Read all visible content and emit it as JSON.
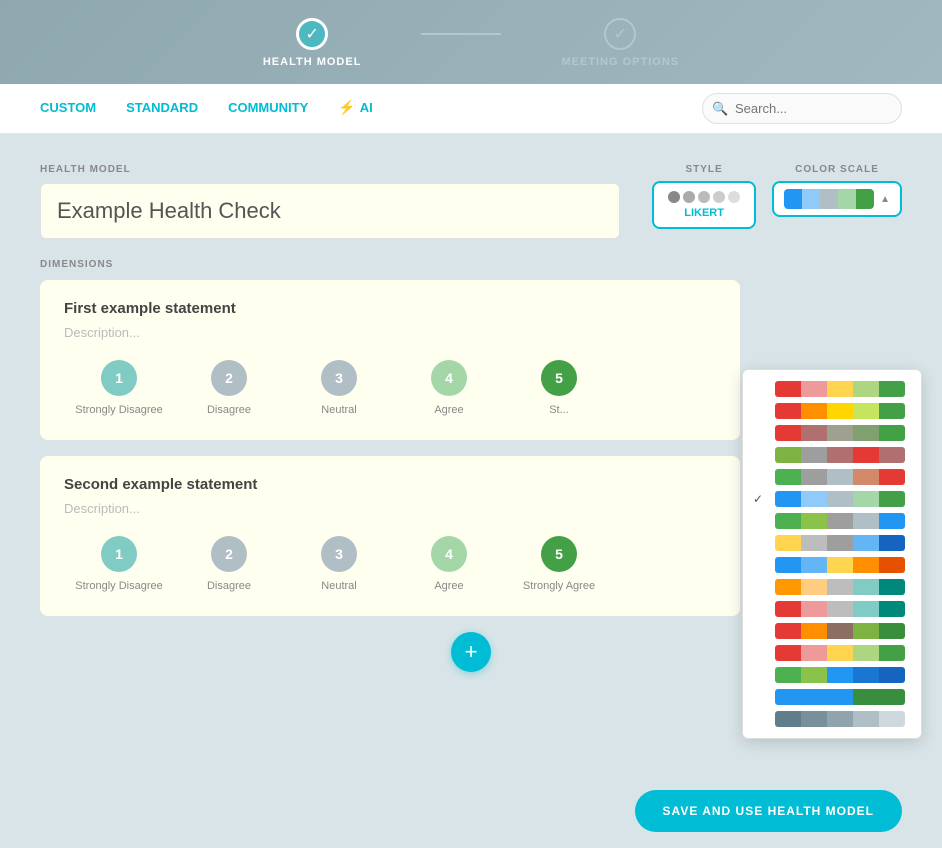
{
  "stepper": {
    "steps": [
      {
        "id": "health-model",
        "label": "HEALTH MODEL",
        "state": "active"
      },
      {
        "id": "meeting-options",
        "label": "MEETING OPTIONS",
        "state": "inactive"
      }
    ]
  },
  "nav": {
    "tabs": [
      {
        "id": "custom",
        "label": "CUSTOM"
      },
      {
        "id": "standard",
        "label": "STANDARD"
      },
      {
        "id": "community",
        "label": "COMMUNITY"
      },
      {
        "id": "ai",
        "label": "AI"
      }
    ],
    "search": {
      "placeholder": "Search...",
      "value": ""
    }
  },
  "health_model": {
    "label": "HEALTH MODEL",
    "name": "Example Health Check"
  },
  "style": {
    "label": "STYLE",
    "selected": "LIKERT"
  },
  "color_scale": {
    "label": "COLOR SCALE",
    "selected_index": 5,
    "options": [
      {
        "colors": [
          "#e53935",
          "#ef9a9a",
          "#ffd54f",
          "#aed581",
          "#43a047"
        ]
      },
      {
        "colors": [
          "#e53935",
          "#ff8f00",
          "#ffd600",
          "#c6e55e",
          "#43a047"
        ]
      },
      {
        "colors": [
          "#e53935",
          "#b07070",
          "#a0a090",
          "#80a070",
          "#43a047"
        ]
      },
      {
        "colors": [
          "#7cb342",
          "#9e9e9e",
          "#b07070",
          "#e53935",
          "#b07070"
        ]
      },
      {
        "colors": [
          "#4caf50",
          "#9e9e9e",
          "#b0bec5",
          "#d4886a",
          "#e53935"
        ]
      },
      {
        "colors": [
          "#2196f3",
          "#90caf9",
          "#b0bec5",
          "#a5d6a7",
          "#43a047"
        ]
      },
      {
        "colors": [
          "#4caf50",
          "#8bc34a",
          "#9e9e9e",
          "#b0bec5",
          "#2196f3"
        ]
      },
      {
        "colors": [
          "#ffd54f",
          "#bdbdbd",
          "#9e9e9e",
          "#64b5f6",
          "#1565c0"
        ]
      },
      {
        "colors": [
          "#2196f3",
          "#64b5f6",
          "#ffd54f",
          "#ff8f00",
          "#e65100"
        ]
      },
      {
        "colors": [
          "#ff9800",
          "#ffcc80",
          "#bdbdbd",
          "#80cbc4",
          "#00897b"
        ]
      },
      {
        "colors": [
          "#e53935",
          "#ef9a9a",
          "#bdbdbd",
          "#80cbc4",
          "#00897b"
        ]
      },
      {
        "colors": [
          "#e53935",
          "#ff8f00",
          "#8d6e63",
          "#7cb342",
          "#388e3c"
        ]
      },
      {
        "colors": [
          "#e53935",
          "#ef9a9a",
          "#ffd54f",
          "#aed581",
          "#43a047"
        ]
      },
      {
        "colors": [
          "#4caf50",
          "#8bc34a",
          "#2196f3",
          "#1976d2",
          "#1565c0"
        ]
      },
      {
        "colors": [
          "#2196f3",
          "#2196f3",
          "#2196f3",
          "#388e3c",
          "#388e3c"
        ]
      },
      {
        "colors": [
          "#607d8b",
          "#78909c",
          "#90a4ae",
          "#b0bec5",
          "#cfd8dc"
        ]
      }
    ]
  },
  "dimensions": {
    "label": "DIMENSIONS",
    "statements": [
      {
        "id": "stmt1",
        "title": "First example statement",
        "description": "Description...",
        "scale": [
          {
            "num": "1",
            "label": "Strongly Disagree",
            "color": "#80cbc4"
          },
          {
            "num": "2",
            "label": "Disagree",
            "color": "#b0bec5"
          },
          {
            "num": "3",
            "label": "Neutral",
            "color": "#b0bec5"
          },
          {
            "num": "4",
            "label": "Agree",
            "color": "#a5d6a7"
          },
          {
            "num": "5",
            "label": "Strongly Agree",
            "color": "#43a047"
          }
        ]
      },
      {
        "id": "stmt2",
        "title": "Second example statement",
        "description": "Description...",
        "scale": [
          {
            "num": "1",
            "label": "Strongly Disagree",
            "color": "#80cbc4"
          },
          {
            "num": "2",
            "label": "Disagree",
            "color": "#b0bec5"
          },
          {
            "num": "3",
            "label": "Neutral",
            "color": "#b0bec5"
          },
          {
            "num": "4",
            "label": "Agree",
            "color": "#a5d6a7"
          },
          {
            "num": "5",
            "label": "Strongly Agree",
            "color": "#43a047"
          }
        ]
      }
    ]
  },
  "add_button": {
    "label": "+"
  },
  "save_button": {
    "label": "SAVE AND USE HEALTH MODEL"
  }
}
